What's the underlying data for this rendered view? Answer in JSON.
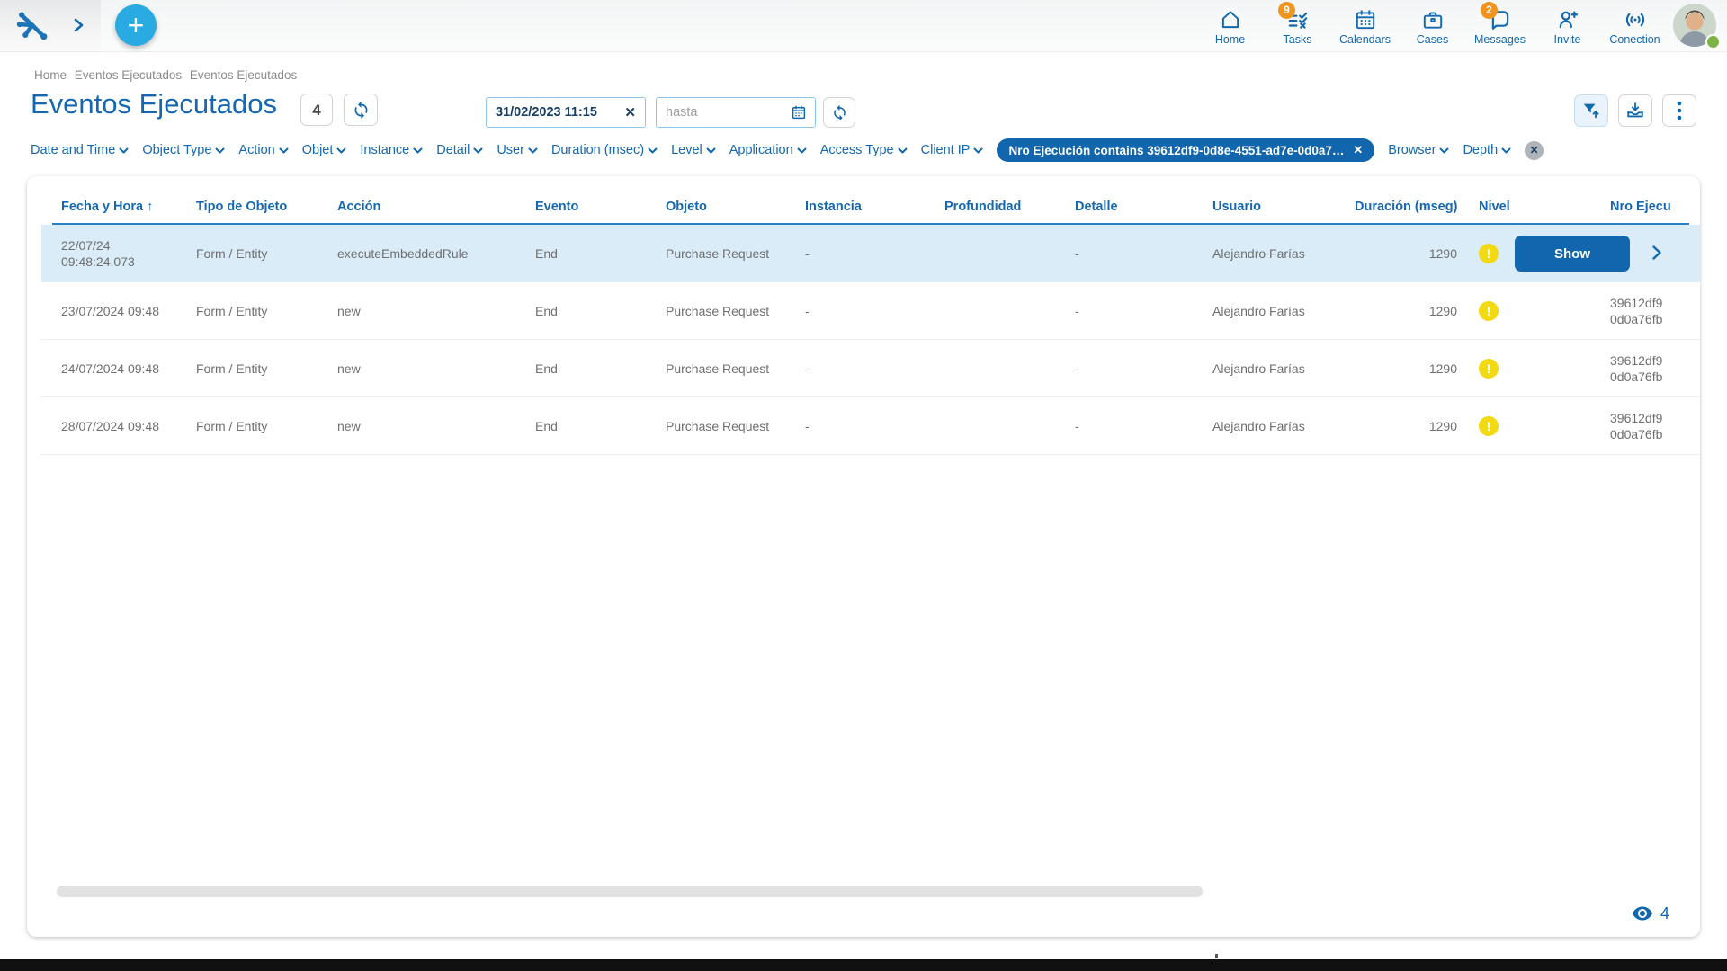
{
  "colors": {
    "primary_blue": "#1268ad",
    "chip_blue": "#1266ad",
    "selected_row_blue": "#d9ecf8",
    "badge_orange": "#f0941d",
    "warning_yellow": "#f3d912",
    "add_button_blue": "#29abe2",
    "online_green": "#7cb342",
    "header_underline_blue": "#2b7fc3"
  },
  "icons": {
    "add_glyph": "+",
    "sort_asc_glyph": "↑",
    "close_glyph": "✕",
    "chip_close_glyph": "✕",
    "clear_all_glyph": "✕",
    "warning_glyph": "!"
  },
  "topbar": {
    "nav": [
      {
        "label": "Home",
        "badge": ""
      },
      {
        "label": "Tasks",
        "badge": "9"
      },
      {
        "label": "Calendars",
        "badge": ""
      },
      {
        "label": "Cases",
        "badge": ""
      },
      {
        "label": "Messages",
        "badge": "2"
      },
      {
        "label": "Invite",
        "badge": ""
      },
      {
        "label": "Conection",
        "badge": ""
      }
    ]
  },
  "breadcrumb": {
    "items": [
      "Home",
      "Eventos Ejecutados",
      "Eventos Ejecutados"
    ]
  },
  "header": {
    "title": "Eventos Ejecutados",
    "count": "4"
  },
  "filters": {
    "date_from": "31/02/2023 11:15",
    "date_to_placeholder": "hasta",
    "dropdowns": [
      "Date and Time",
      "Object Type",
      "Action",
      "Objet",
      "Instance",
      "Detail",
      "User",
      "Duration (msec)",
      "Level",
      "Application",
      "Access Type",
      "Client IP"
    ],
    "chip": "Nro Ejecución contains 39612df9-0d8e-4551-ad7e-0d0a7…",
    "more_dropdowns": [
      "Browser",
      "Depth"
    ]
  },
  "table": {
    "columns": [
      "Fecha y Hora",
      "Tipo de Objeto",
      "Acción",
      "Evento",
      "Objeto",
      "Instancia",
      "Profundidad",
      "Detalle",
      "Usuario",
      "Duración (mseg)",
      "Nivel",
      "Nro Ejecu"
    ],
    "rows": [
      {
        "fecha_line1": "22/07/24",
        "fecha_line2": "09:48:24.073",
        "tipo": "Form / Entity",
        "accion": "executeEmbeddedRule",
        "evento": "End",
        "objeto": "Purchase Request",
        "instancia": "-",
        "profundidad": "",
        "detalle": "-",
        "usuario": "Alejandro Farías",
        "duracion": "1290",
        "nivel": "warning",
        "action": "Show",
        "nro_line1": "",
        "nro_line2": ""
      },
      {
        "fecha_line1": "23/07/2024 09:48",
        "fecha_line2": "",
        "tipo": "Form / Entity",
        "accion": "new",
        "evento": "End",
        "objeto": "Purchase Request",
        "instancia": "-",
        "profundidad": "",
        "detalle": "-",
        "usuario": "Alejandro Farías",
        "duracion": "1290",
        "nivel": "warning",
        "nro_line1": "39612df9",
        "nro_line2": "0d0a76fb"
      },
      {
        "fecha_line1": "24/07/2024 09:48",
        "fecha_line2": "",
        "tipo": "Form / Entity",
        "accion": "new",
        "evento": "End",
        "objeto": "Purchase Request",
        "instancia": "-",
        "profundidad": "",
        "detalle": "-",
        "usuario": "Alejandro Farías",
        "duracion": "1290",
        "nivel": "warning",
        "nro_line1": "39612df9",
        "nro_line2": "0d0a76fb"
      },
      {
        "fecha_line1": "28/07/2024 09:48",
        "fecha_line2": "",
        "tipo": "Form / Entity",
        "accion": "new",
        "evento": "End",
        "objeto": "Purchase Request",
        "instancia": "-",
        "profundidad": "",
        "detalle": "-",
        "usuario": "Alejandro Farías",
        "duracion": "1290",
        "nivel": "warning",
        "nro_line1": "39612df9",
        "nro_line2": "0d0a76fb"
      }
    ],
    "visible_count": "4"
  }
}
